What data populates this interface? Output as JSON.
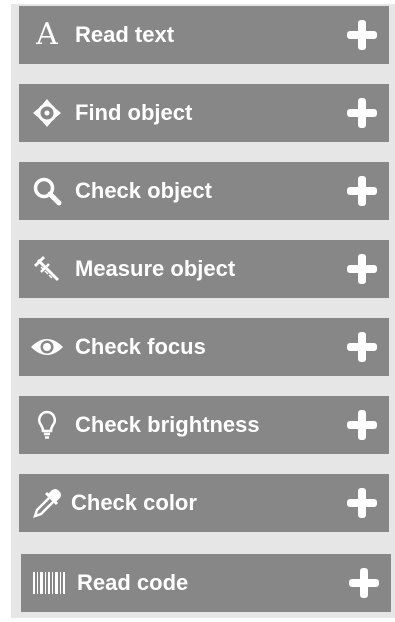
{
  "tools": [
    {
      "label": "Read text",
      "icon": "letter-a-icon"
    },
    {
      "label": "Find object",
      "icon": "crosshair-icon"
    },
    {
      "label": "Check object",
      "icon": "magnifier-icon"
    },
    {
      "label": "Measure object",
      "icon": "caliper-icon"
    },
    {
      "label": "Check focus",
      "icon": "eye-icon"
    },
    {
      "label": "Check brightness",
      "icon": "lightbulb-icon"
    },
    {
      "label": "Check color",
      "icon": "eyedropper-icon"
    },
    {
      "label": "Read code",
      "icon": "barcode-icon"
    }
  ],
  "icon_letter": "A",
  "colors": {
    "panel_background": "#e6e6e6",
    "tile_background": "#878787",
    "foreground": "#ffffff"
  }
}
